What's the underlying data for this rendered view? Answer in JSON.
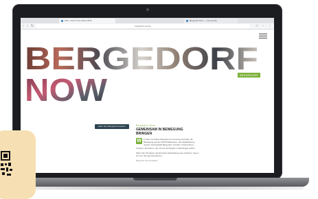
{
  "browser": {
    "tab1_label": "CDJ - Club of the Artists 2019",
    "tab2_label": "Bergedorf Now — Community",
    "url": "bergedorf-now.de"
  },
  "hero": {
    "word1": "BERGEDORF",
    "word2": "NOW",
    "label": "BERGEDORF"
  },
  "cta_label": "Mehr über Bergedorf erfahren",
  "article": {
    "kicker": "Bergedorf Now",
    "headline": "GEMEINSAM IN BEWEGUNG BRINGEN",
    "dropcap": "W",
    "body1": "ir leben und lieben Bergedorf und sind gemeinsam die Bewegung aus der Wirtschaftsregion, die Digitalisierung unserer Heimatstadt Bergedorf, Gründer, Unternehmer, Kreative, Menschen, die mit uns die Region voranbringen wollen.",
    "body2": "Wenn Sie Teil dieser dynamischen Entwicklung sein möchten, freuen wir uns, Sie kennenzulernen.",
    "author": "Bergedorf Now Redaktion"
  },
  "colors": {
    "accent": "#7cb13a",
    "cta": "#2f4350",
    "laptop": "#1c1d20",
    "card": "#f6dfb2"
  }
}
